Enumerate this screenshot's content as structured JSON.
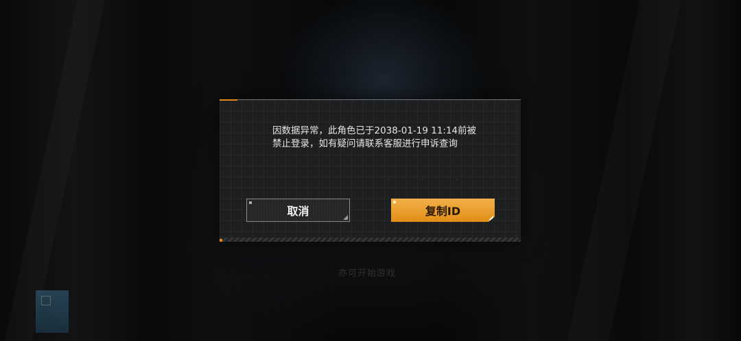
{
  "background": {
    "faded_text": "亦可开始游戏"
  },
  "dialog": {
    "message": "因数据异常，此角色已于2038-01-19 11:14前被禁止登录，如有疑问请联系客服进行申诉查询",
    "buttons": {
      "cancel_label": "取消",
      "copy_id_label": "复制ID"
    },
    "accent_color": "#e58a1a"
  }
}
